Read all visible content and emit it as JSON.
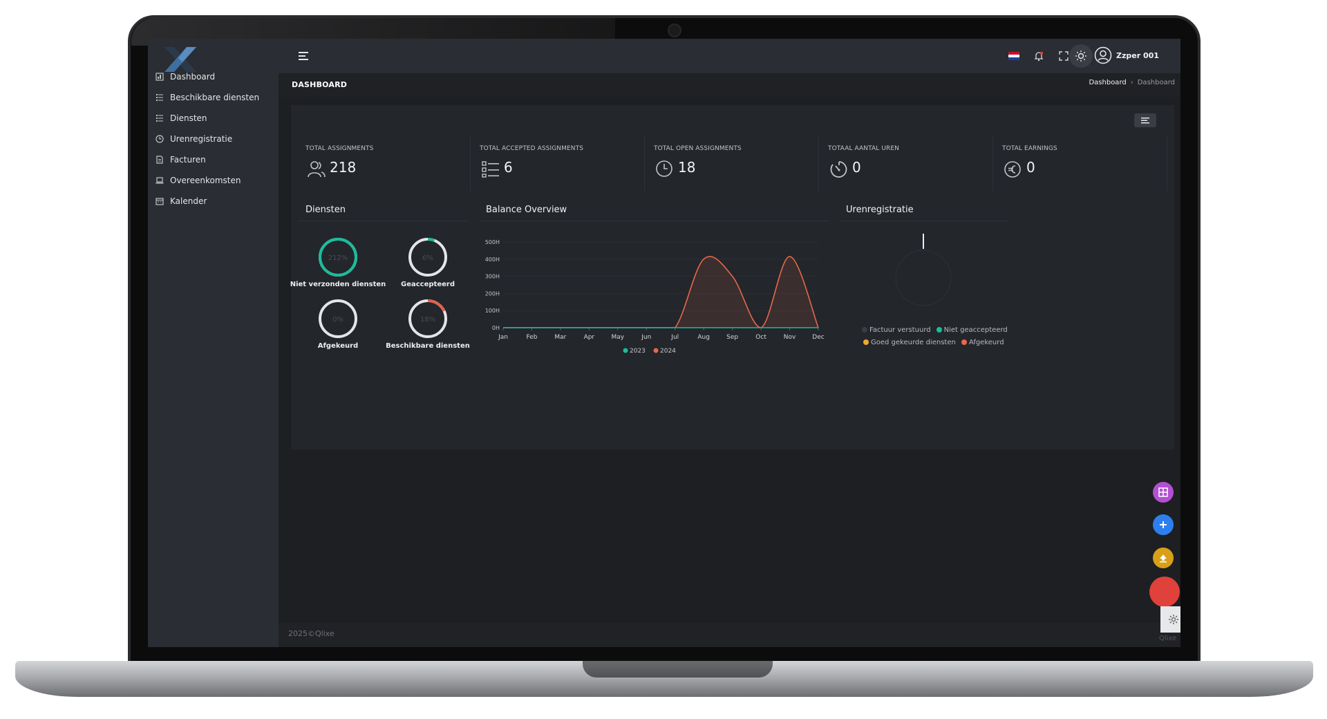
{
  "sidebar": {
    "items": [
      {
        "label": "Dashboard",
        "icon": "dashboard-icon"
      },
      {
        "label": "Beschikbare diensten",
        "icon": "list-icon"
      },
      {
        "label": "Diensten",
        "icon": "list-icon"
      },
      {
        "label": "Urenregistratie",
        "icon": "clock-icon"
      },
      {
        "label": "Facturen",
        "icon": "document-icon"
      },
      {
        "label": "Overeenkomsten",
        "icon": "laptop-icon"
      },
      {
        "label": "Kalender",
        "icon": "calendar-icon"
      }
    ]
  },
  "topbar": {
    "user_name": "Zzper 001"
  },
  "header": {
    "title": "DASHBOARD",
    "breadcrumb": {
      "link": "Dashboard",
      "current": "Dashboard"
    }
  },
  "stats": [
    {
      "label": "TOTAL ASSIGNMENTS",
      "value": "218",
      "icon": "users-icon"
    },
    {
      "label": "TOTAL ACCEPTED ASSIGNMENTS",
      "value": "6",
      "icon": "list-icon"
    },
    {
      "label": "TOTAL OPEN ASSIGNMENTS",
      "value": "18",
      "icon": "clock-icon"
    },
    {
      "label": "TOTAAL AANTAL UREN",
      "value": "0",
      "icon": "stopwatch-icon"
    },
    {
      "label": "TOTAL EARNINGS",
      "value": "0",
      "icon": "euro-icon"
    }
  ],
  "diensten": {
    "title": "Diensten",
    "items": [
      {
        "label": "Niet verzonden diensten",
        "percent_text": "212%",
        "fraction": 1.0,
        "color": "#1abc9c"
      },
      {
        "label": "Geaccepteerd",
        "percent_text": "6%",
        "fraction": 0.06,
        "color": "#1abc9c"
      },
      {
        "label": "Afgekeurd",
        "percent_text": "0%",
        "fraction": 0.0,
        "color": "#e0624f"
      },
      {
        "label": "Beschikbare diensten",
        "percent_text": "18%",
        "fraction": 0.18,
        "color": "#e0624f"
      }
    ]
  },
  "balance": {
    "title": "Balance Overview",
    "chart_data": {
      "type": "area",
      "categories": [
        "Jan",
        "Feb",
        "Mar",
        "Apr",
        "May",
        "Jun",
        "Jul",
        "Aug",
        "Sep",
        "Oct",
        "Nov",
        "Dec"
      ],
      "y_ticks": [
        "0H",
        "100H",
        "200H",
        "300H",
        "400H",
        "500H"
      ],
      "ylim": [
        0,
        500
      ],
      "series": [
        {
          "name": "2023",
          "color": "#1abc9c",
          "values": [
            0,
            0,
            0,
            0,
            0,
            0,
            0,
            0,
            0,
            0,
            0,
            0
          ]
        },
        {
          "name": "2024",
          "color": "#e8684a",
          "values": [
            0,
            0,
            0,
            0,
            0,
            0,
            0,
            400,
            300,
            0,
            415,
            0
          ]
        }
      ],
      "legend": "bottom-center",
      "grid": true
    }
  },
  "uren": {
    "title": "Urenregistratie",
    "legend": [
      {
        "label": "Factuur verstuurd",
        "color": "#3a3d44"
      },
      {
        "label": "Niet geaccepteerd",
        "color": "#1abc9c"
      },
      {
        "label": "Goed gekeurde diensten",
        "color": "#f0a830"
      },
      {
        "label": "Afgekeurd",
        "color": "#e8684a"
      }
    ]
  },
  "fabs": [
    {
      "name": "grid-fab",
      "color": "#b34fd1",
      "icon": "grid-icon"
    },
    {
      "name": "add-fab",
      "color": "#2d7ff0",
      "icon": "plus-icon"
    },
    {
      "name": "upload-fab",
      "color": "#d9a017",
      "icon": "upload-icon"
    },
    {
      "name": "record-fab",
      "color": "#e0413a",
      "icon": ""
    }
  ],
  "footer": {
    "text": "2025©Qlixe",
    "brand": "Qlixe"
  },
  "colors": {
    "accent": "#1abc9c",
    "danger": "#e8684a",
    "sidebar": "#2a2d33",
    "content": "#1d1f23"
  }
}
